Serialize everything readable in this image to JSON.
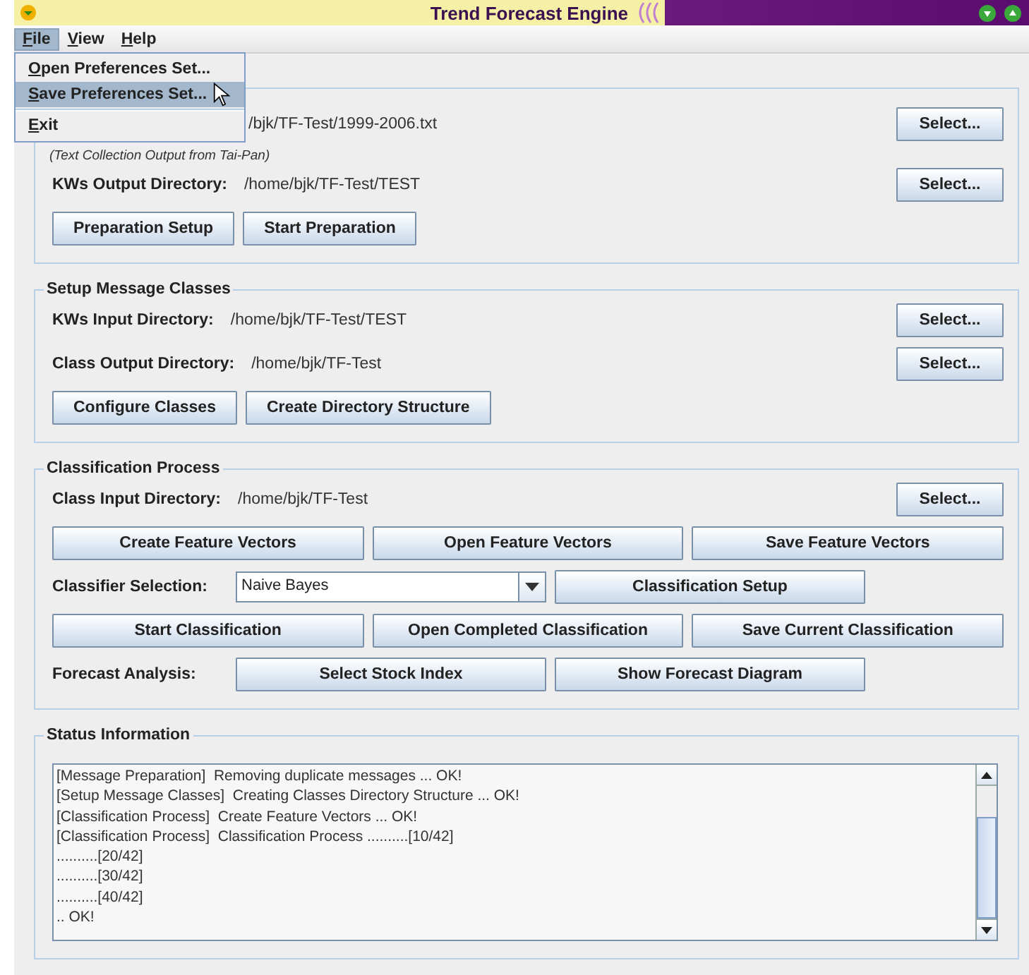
{
  "window": {
    "title": "Trend Forecast Engine"
  },
  "menu_bar": [
    {
      "label": "File",
      "selected": true
    },
    {
      "label": "View",
      "selected": false
    },
    {
      "label": "Help",
      "selected": false
    }
  ],
  "file_menu": {
    "items": [
      {
        "kind": "item",
        "label": "Open Preferences Set...",
        "selected": false
      },
      {
        "kind": "item",
        "label": "Save Preferences Set...",
        "selected": true
      },
      {
        "kind": "separator"
      },
      {
        "kind": "item",
        "label": "Exit",
        "selected": false
      }
    ]
  },
  "panels": [
    {
      "rows": [
        {
          "kind": "path",
          "value": "/bjk/TF-Test/1999-2006.txt",
          "note": "(Text Collection Output from Tai-Pan)",
          "button": "Select..."
        },
        {
          "kind": "path",
          "label": "KWs Output Directory:",
          "value": "/home/bjk/TF-Test/TEST",
          "button": "Select..."
        },
        {
          "kind": "buttons",
          "buttons": [
            "Preparation Setup",
            "Start Preparation"
          ]
        }
      ]
    },
    {
      "title": "Setup Message Classes",
      "rows": [
        {
          "kind": "path",
          "label": "KWs Input Directory:",
          "value": "/home/bjk/TF-Test/TEST",
          "button": "Select..."
        },
        {
          "kind": "path",
          "label": "Class Output Directory:",
          "value": "/home/bjk/TF-Test",
          "button": "Select..."
        },
        {
          "kind": "buttons",
          "buttons": [
            "Configure Classes",
            "Create Directory Structure"
          ]
        }
      ]
    },
    {
      "title": "Classification Process",
      "rows": [
        {
          "kind": "path",
          "label": "Class Input Directory:",
          "value": "/home/bjk/TF-Test",
          "button": "Select..."
        },
        {
          "kind": "grid",
          "buttons": [
            "Create Feature Vectors",
            "Open Feature Vectors",
            "Save Feature Vectors"
          ]
        },
        {
          "kind": "combo",
          "label": "Classifier Selection:",
          "value": "Naive Bayes",
          "buttons": [
            "Classification Setup"
          ]
        },
        {
          "kind": "grid",
          "buttons": [
            "Start Classification",
            "Open Completed Classification",
            "Save Current Classification"
          ]
        },
        {
          "kind": "actions",
          "label": "Forecast Analysis:",
          "buttons": [
            "Select Stock Index",
            "Show Forecast Diagram"
          ]
        }
      ]
    }
  ],
  "status": {
    "title": "Status Information",
    "lines": [
      "[Message Preparation]  Removing duplicate messages ... OK!",
      "[Setup Message Classes]  Creating Classes Directory Structure ... OK!",
      "[Classification Process]  Create Feature Vectors ... OK!",
      "[Classification Process]  Classification Process ..........[10/42]",
      "..........[20/42]",
      "..........[30/42]",
      "..........[40/42]",
      ".. OK!"
    ]
  }
}
